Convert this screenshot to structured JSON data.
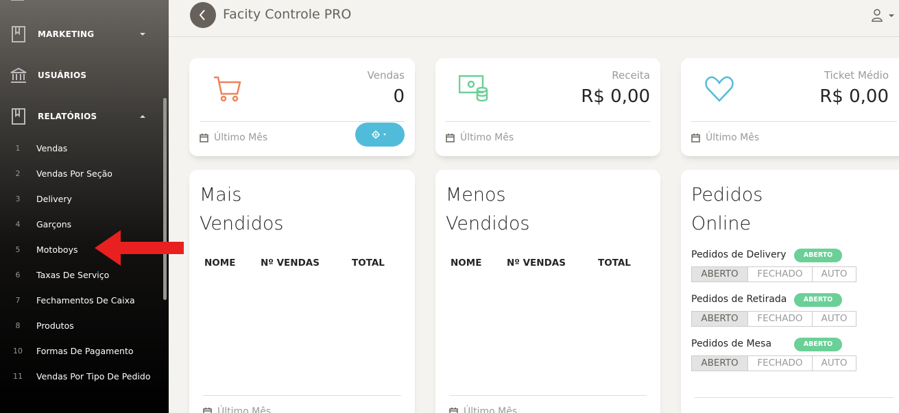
{
  "sidebar": {
    "sections": [
      {
        "label": "MARKETING",
        "icon": "book-icon",
        "caret": "down"
      },
      {
        "label": "USUÁRIOS",
        "icon": "bank-icon"
      },
      {
        "label": "RELATÓRIOS",
        "icon": "book-icon",
        "caret": "up"
      }
    ],
    "items": [
      {
        "num": "1",
        "label": "Vendas"
      },
      {
        "num": "2",
        "label": "Vendas Por Seção"
      },
      {
        "num": "3",
        "label": "Delivery"
      },
      {
        "num": "4",
        "label": "Garçons"
      },
      {
        "num": "5",
        "label": "Motoboys"
      },
      {
        "num": "6",
        "label": "Taxas De Serviço"
      },
      {
        "num": "7",
        "label": "Fechamentos De Caixa"
      },
      {
        "num": "8",
        "label": "Produtos"
      },
      {
        "num": "10",
        "label": "Formas De Pagamento"
      },
      {
        "num": "11",
        "label": "Vendas Por Tipo De Pedido"
      }
    ]
  },
  "header": {
    "title": "Facity Controle PRO"
  },
  "stats": [
    {
      "category": "Vendas",
      "value": "0",
      "footer": "Último Mês",
      "icon": "cart-icon",
      "color": "#ef8157"
    },
    {
      "category": "Receita",
      "value": "R$ 0,00",
      "footer": "Último Mês",
      "icon": "money-icon",
      "color": "#6bd098"
    },
    {
      "category": "Ticket Médio",
      "value": "R$ 0,00",
      "footer": "Último Mês",
      "icon": "heart-icon",
      "color": "#51bcda"
    }
  ],
  "mais_vendidos": {
    "title_line1": "Mais",
    "title_line2": "Vendidos",
    "columns": [
      "NOME",
      "Nº VENDAS",
      "TOTAL"
    ],
    "footer": "Último Mês"
  },
  "menos_vendidos": {
    "title_line1": "Menos",
    "title_line2": "Vendidos",
    "columns": [
      "NOME",
      "Nº VENDAS",
      "TOTAL"
    ],
    "footer": "Último Mês"
  },
  "pedidos_online": {
    "title_line1": "Pedidos",
    "title_line2": "Online",
    "rows": [
      {
        "label": "Pedidos de Delivery",
        "status": "ABERTO",
        "options": [
          "ABERTO",
          "FECHADO",
          "AUTO"
        ],
        "selected": "ABERTO"
      },
      {
        "label": "Pedidos de Retirada",
        "status": "ABERTO",
        "options": [
          "ABERTO",
          "FECHADO",
          "AUTO"
        ],
        "selected": "ABERTO"
      },
      {
        "label": "Pedidos de Mesa",
        "status": "ABERTO",
        "options": [
          "ABERTO",
          "FECHADO",
          "AUTO"
        ],
        "selected": "ABERTO"
      }
    ]
  },
  "colors": {
    "accent_arrow": "#e8201f",
    "badge": "#6bd098",
    "gear_button": "#51bcda"
  }
}
